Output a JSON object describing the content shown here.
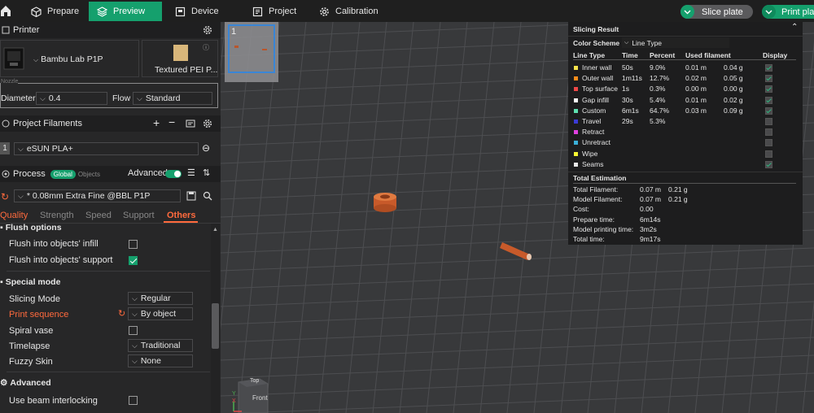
{
  "topbar": {
    "tabs": [
      {
        "label": "Prepare"
      },
      {
        "label": "Preview"
      },
      {
        "label": "Device"
      },
      {
        "label": "Project"
      },
      {
        "label": "Calibration"
      }
    ],
    "slice_plate": "Slice plate",
    "print_plate": "Print pla"
  },
  "printer": {
    "section_title": "Printer",
    "name": "Bambu Lab P1P",
    "plate": "Textured PEI P...",
    "nozzle_label": "Nozzle",
    "diameter_label": "Diameter",
    "diameter_value": "0.4",
    "flow_label": "Flow",
    "flow_value": "Standard"
  },
  "filaments": {
    "section_title": "Project Filaments",
    "items": [
      {
        "index": "1",
        "name": "eSUN PLA+"
      }
    ]
  },
  "process": {
    "section_title": "Process",
    "global_label": "Global",
    "objects_label": "Objects",
    "advanced_label": "Advanced",
    "profile": "* 0.08mm Extra Fine @BBL P1P",
    "tabs": [
      "Quality",
      "Strength",
      "Speed",
      "Support",
      "Others"
    ],
    "groups": {
      "flush_title": "Flush options",
      "flush_infill": "Flush into objects' infill",
      "flush_support": "Flush into objects' support",
      "special_title": "Special mode",
      "slicing_mode_label": "Slicing Mode",
      "slicing_mode_value": "Regular",
      "print_sequence_label": "Print sequence",
      "print_sequence_value": "By object",
      "spiral_vase_label": "Spiral vase",
      "timelapse_label": "Timelapse",
      "timelapse_value": "Traditional",
      "fuzzy_skin_label": "Fuzzy Skin",
      "fuzzy_skin_value": "None",
      "advanced_title": "Advanced",
      "beam_label": "Use beam interlocking"
    }
  },
  "viewport": {
    "plate_number": "1",
    "axis_top": "Top",
    "axis_front": "Front",
    "axis_x": "X",
    "axis_y": "Y"
  },
  "slicing_result": {
    "title": "Slicing Result",
    "color_scheme_label": "Color Scheme",
    "color_scheme_value": "Line Type",
    "headers": {
      "type": "Line Type",
      "time": "Time",
      "percent": "Percent",
      "used": "Used filament",
      "display": "Display"
    },
    "rows": [
      {
        "name": "Inner wall",
        "color": "#f7e34b",
        "time": "50s",
        "percent": "9.0%",
        "m": "0.01 m",
        "g": "0.04 g",
        "display": true
      },
      {
        "name": "Outer wall",
        "color": "#ff8c1a",
        "time": "1m11s",
        "percent": "12.7%",
        "m": "0.02 m",
        "g": "0.05 g",
        "display": true
      },
      {
        "name": "Top surface",
        "color": "#f04848",
        "time": "1s",
        "percent": "0.3%",
        "m": "0.00 m",
        "g": "0.00 g",
        "display": true
      },
      {
        "name": "Gap infill",
        "color": "#ffffff",
        "time": "30s",
        "percent": "5.4%",
        "m": "0.01 m",
        "g": "0.02 g",
        "display": true
      },
      {
        "name": "Custom",
        "color": "#5ee0b0",
        "time": "6m1s",
        "percent": "64.7%",
        "m": "0.03 m",
        "g": "0.09 g",
        "display": true
      },
      {
        "name": "Travel",
        "color": "#3b3bd6",
        "time": "29s",
        "percent": "5.3%",
        "m": "",
        "g": "",
        "display": false
      },
      {
        "name": "Retract",
        "color": "#e040e0",
        "time": "",
        "percent": "",
        "m": "",
        "g": "",
        "display": false
      },
      {
        "name": "Unretract",
        "color": "#3ab0d8",
        "time": "",
        "percent": "",
        "m": "",
        "g": "",
        "display": false
      },
      {
        "name": "Wipe",
        "color": "#f5f532",
        "time": "",
        "percent": "",
        "m": "",
        "g": "",
        "display": false
      },
      {
        "name": "Seams",
        "color": "#e8e8e8",
        "time": "",
        "percent": "",
        "m": "",
        "g": "",
        "display": true
      }
    ],
    "estimation_title": "Total Estimation",
    "estimation": [
      {
        "label": "Total Filament:",
        "v1": "0.07 m",
        "v2": "0.21 g"
      },
      {
        "label": "Model Filament:",
        "v1": "0.07 m",
        "v2": "0.21 g"
      },
      {
        "label": "Cost:",
        "v1": "0.00",
        "v2": ""
      },
      {
        "label": "Prepare time:",
        "v1": "6m14s",
        "v2": ""
      },
      {
        "label": "Model printing time:",
        "v1": "3m2s",
        "v2": ""
      },
      {
        "label": "Total time:",
        "v1": "9m17s",
        "v2": ""
      }
    ]
  },
  "colors": {
    "accent": "#15a06d",
    "warning": "#ff6a3d",
    "model": "#c85a2a"
  }
}
